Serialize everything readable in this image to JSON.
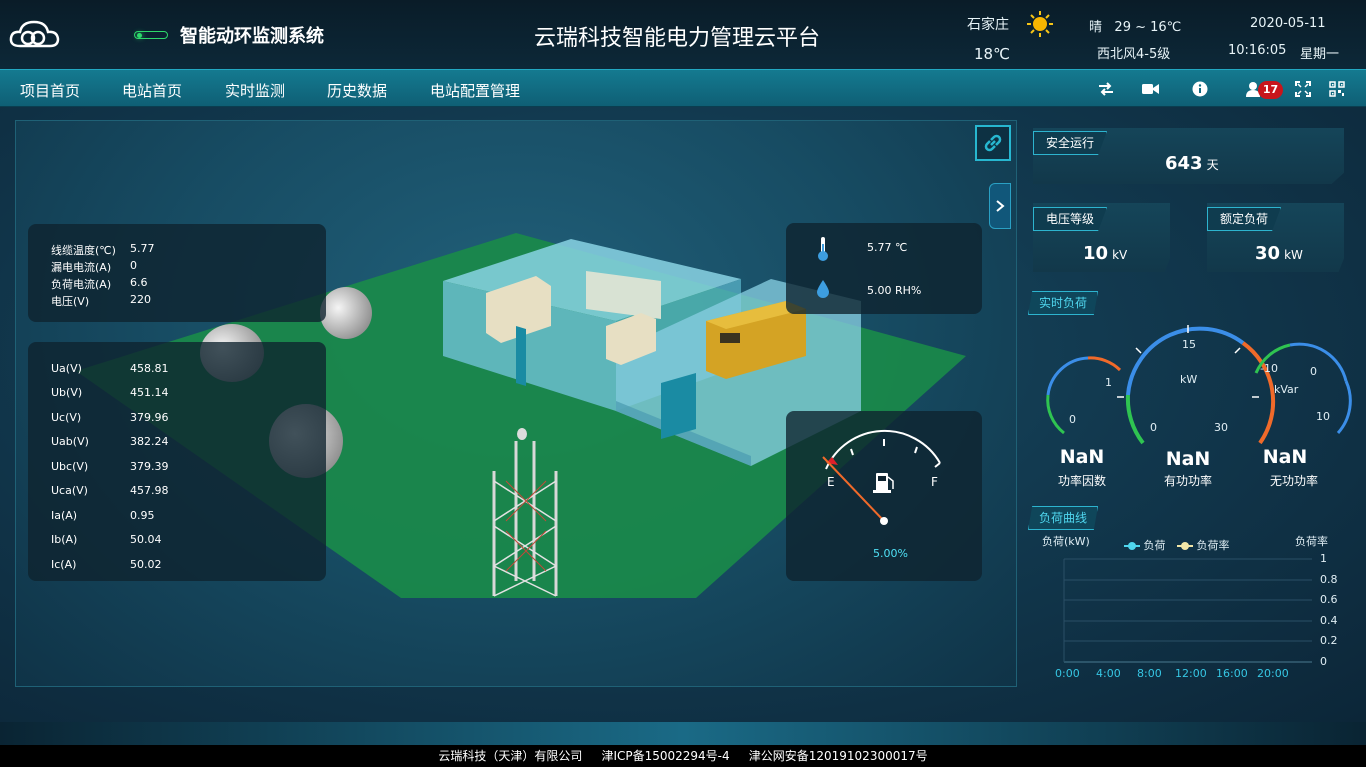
{
  "header": {
    "system_name": "智能动环监测系统",
    "platform_title": "云瑞科技智能电力管理云平台",
    "weather": {
      "city": "石家庄",
      "current_temp": "18℃",
      "condition": "晴",
      "range": "29 ~ 16℃",
      "wind": "西北风4-5级",
      "icon": "sun-icon"
    },
    "date": "2020-05-11",
    "time": "10:16:05",
    "weekday": "星期一"
  },
  "nav": {
    "items": [
      "项目首页",
      "电站首页",
      "实时监测",
      "历史数据",
      "电站配置管理"
    ],
    "icons": [
      "switch-icon",
      "video-camera-icon",
      "info-icon",
      "user-icon",
      "fullscreen-icon",
      "qrcode-icon"
    ],
    "alarm_count": "17"
  },
  "cable_panel": {
    "rows": [
      {
        "label": "线缆温度(℃)",
        "value": "5.77"
      },
      {
        "label": "漏电电流(A)",
        "value": "0"
      },
      {
        "label": "负荷电流(A)",
        "value": "6.6"
      },
      {
        "label": "电压(V)",
        "value": "220"
      }
    ]
  },
  "electric_panel": {
    "rows": [
      {
        "label": "Ua(V)",
        "value": "458.81"
      },
      {
        "label": "Ub(V)",
        "value": "451.14"
      },
      {
        "label": "Uc(V)",
        "value": "379.96"
      },
      {
        "label": "Uab(V)",
        "value": "382.24"
      },
      {
        "label": "Ubc(V)",
        "value": "379.39"
      },
      {
        "label": "Uca(V)",
        "value": "457.98"
      },
      {
        "label": "Ia(A)",
        "value": "0.95"
      },
      {
        "label": "Ib(A)",
        "value": "50.04"
      },
      {
        "label": "Ic(A)",
        "value": "50.02"
      }
    ]
  },
  "env_panel": {
    "temperature": "5.77 ℃",
    "humidity": "5.00 RH%"
  },
  "fuel_panel": {
    "empty_label": "E",
    "full_label": "F",
    "level_text": "5.00%",
    "level": 0.05
  },
  "stats": {
    "safe_run": {
      "label": "安全运行",
      "value": "643",
      "unit": "天"
    },
    "voltage_level": {
      "label": "电压等级",
      "value": "10",
      "unit": "kV"
    },
    "rated_load": {
      "label": "额定负荷",
      "value": "30",
      "unit": "kW"
    }
  },
  "realtime": {
    "title": "实时负荷",
    "gauges": [
      {
        "name": "功率因数",
        "value": "NaN",
        "ticks": [
          "0",
          "1"
        ]
      },
      {
        "name": "有功功率",
        "value": "NaN",
        "unit": "kW",
        "ticks": [
          "0",
          "15",
          "30"
        ]
      },
      {
        "name": "无功功率",
        "value": "NaN",
        "unit": "kVar",
        "ticks": [
          "-10",
          "0",
          "10"
        ]
      }
    ]
  },
  "load_chart": {
    "title": "负荷曲线",
    "left_axis_label": "负荷(kW)",
    "right_axis_label": "负荷率",
    "legend": [
      "负荷",
      "负荷率"
    ],
    "right_ticks": [
      "1",
      "0.8",
      "0.6",
      "0.4",
      "0.2",
      "0"
    ],
    "x_ticks": [
      "0:00",
      "4:00",
      "8:00",
      "12:00",
      "16:00",
      "20:00"
    ]
  },
  "chart_data": {
    "type": "line",
    "title": "负荷曲线",
    "xlabel": "",
    "ylabel": "负荷(kW)",
    "y2label": "负荷率",
    "categories": [
      "0:00",
      "4:00",
      "8:00",
      "12:00",
      "16:00",
      "20:00"
    ],
    "series": [
      {
        "name": "负荷",
        "values": []
      },
      {
        "name": "负荷率",
        "values": []
      }
    ],
    "y2lim": [
      0,
      1
    ],
    "grid": true,
    "legend_position": "top-center"
  },
  "footer": {
    "company": "云瑞科技（天津）有限公司",
    "icp": "津ICP备15002294号-4",
    "police": "津公网安备12019102300017号"
  },
  "colors": {
    "accent": "#2db4cf",
    "green": "#1a8a4a",
    "alarm": "#c8151b",
    "fuel_needle": "#f06a2a"
  }
}
